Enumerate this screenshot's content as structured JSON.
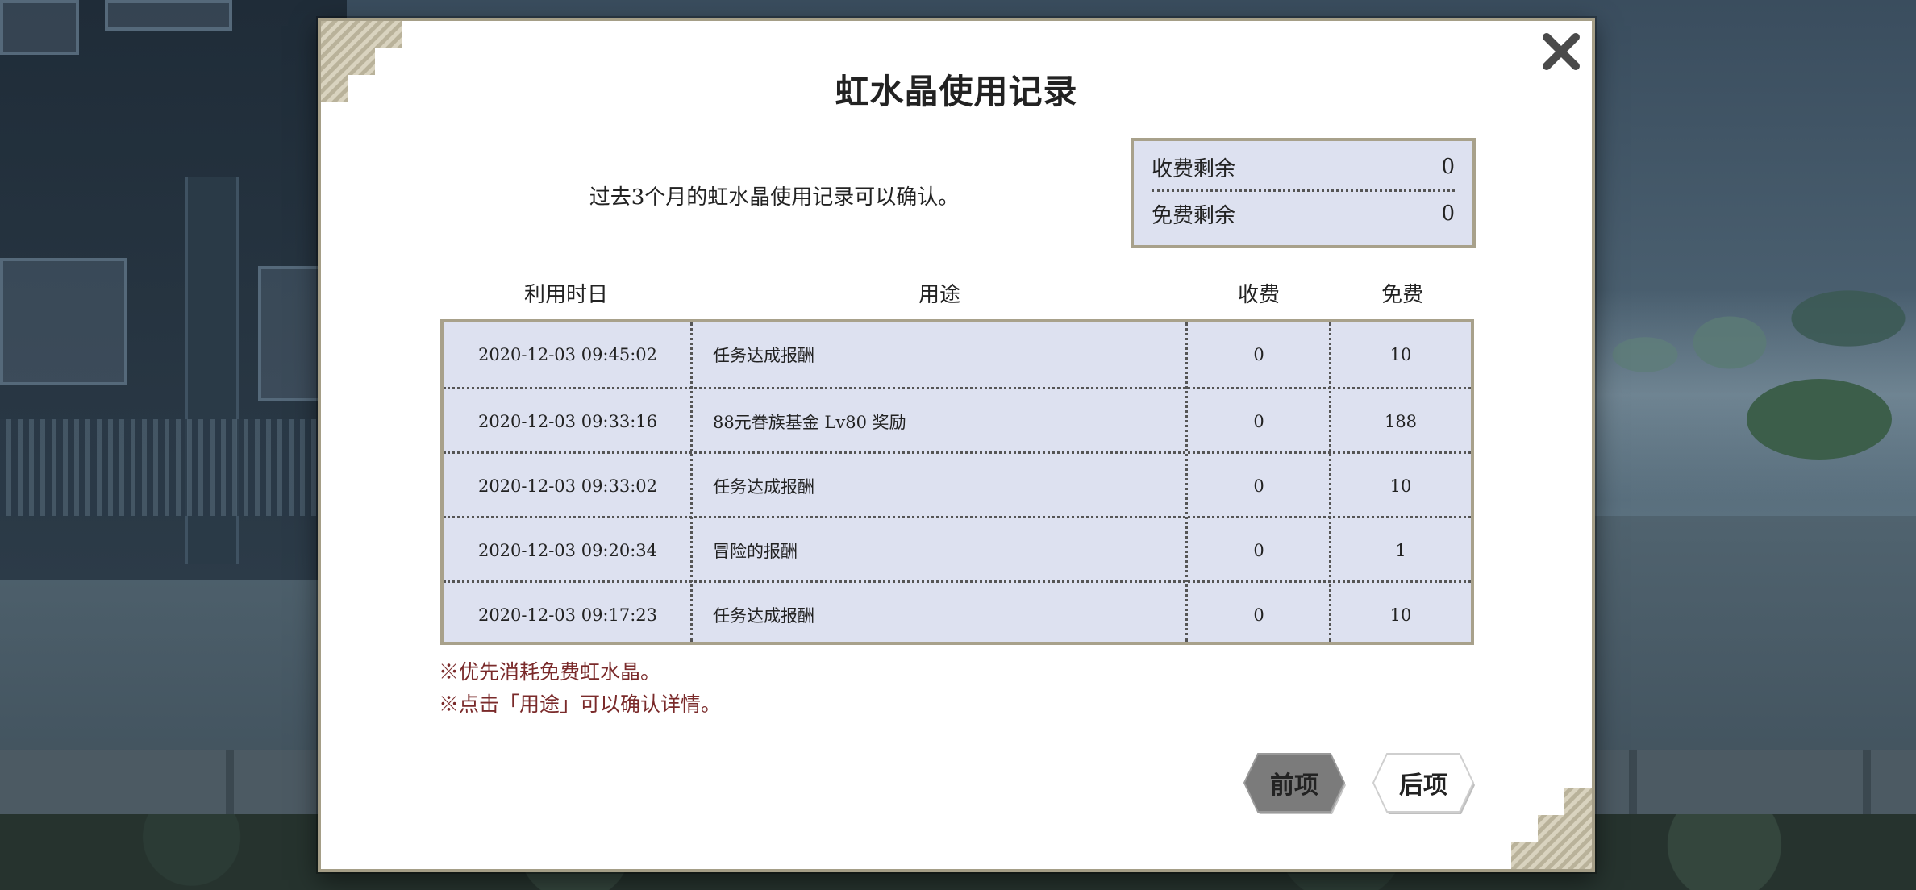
{
  "dialog": {
    "title": "虹水晶使用记录",
    "subtitle": "过去3个月的虹水晶使用记录可以确认。",
    "balance": {
      "paid_label": "收费剩余",
      "paid_value": "0",
      "free_label": "免费剩余",
      "free_value": "0"
    },
    "columns": {
      "date": "利用时日",
      "usage": "用途",
      "paid": "收费",
      "free": "免费"
    },
    "records": [
      {
        "date": "2020-12-03 09:45:02",
        "usage": "任务达成报酬",
        "paid": "0",
        "free": "10"
      },
      {
        "date": "2020-12-03 09:33:16",
        "usage": "88元眷族基金 Lv80 奖励",
        "paid": "0",
        "free": "188"
      },
      {
        "date": "2020-12-03 09:33:02",
        "usage": "任务达成报酬",
        "paid": "0",
        "free": "10"
      },
      {
        "date": "2020-12-03 09:20:34",
        "usage": "冒险的报酬",
        "paid": "0",
        "free": "1"
      },
      {
        "date": "2020-12-03 09:17:23",
        "usage": "任务达成报酬",
        "paid": "0",
        "free": "10"
      }
    ],
    "notes": [
      "※优先消耗免费虹水晶。",
      "※点击「用途」可以确认详情。"
    ],
    "buttons": {
      "prev": "前项",
      "next": "后项"
    }
  },
  "icons": {
    "close": "close-icon",
    "corner": "striped-corner-ornament"
  },
  "colors": {
    "panel_bg": "#dde1f0",
    "frame": "#a8a18b",
    "note_text": "#7a2a2a",
    "prev_button": "#777777",
    "next_button": "#ffffff"
  }
}
